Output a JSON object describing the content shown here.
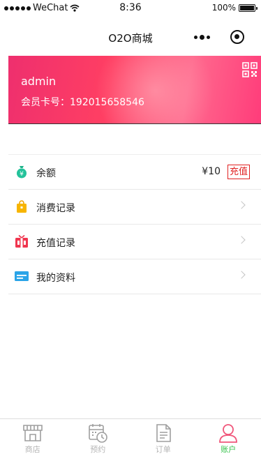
{
  "status_bar": {
    "carrier": "WeChat",
    "time": "8:36",
    "battery": "100%"
  },
  "nav": {
    "title": "O2O商城"
  },
  "profile": {
    "username": "admin",
    "card_label": "会员卡号：192015658546"
  },
  "menu": {
    "balance": {
      "label": "余额",
      "amount": "¥10",
      "action": "充值"
    },
    "items": [
      {
        "label": "消费记录",
        "icon": "shopping-bag-icon"
      },
      {
        "label": "充值记录",
        "icon": "gift-icon"
      },
      {
        "label": "我的资料",
        "icon": "id-card-icon"
      }
    ]
  },
  "tab_bar": {
    "tabs": [
      {
        "label": "商店",
        "icon": "store-icon",
        "active": false
      },
      {
        "label": "预约",
        "icon": "calendar-clock-icon",
        "active": false
      },
      {
        "label": "订单",
        "icon": "document-icon",
        "active": false
      },
      {
        "label": "账户",
        "icon": "user-icon",
        "active": true
      }
    ],
    "active_color": "#35c24b"
  },
  "colors": {
    "banner_accent": "#ff3f63",
    "recharge_accent": "#e02020"
  }
}
